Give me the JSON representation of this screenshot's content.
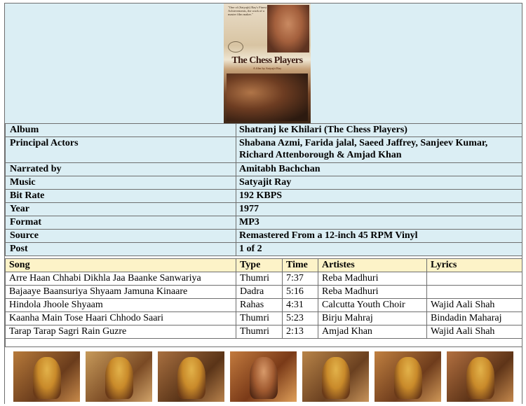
{
  "poster": {
    "quote": "\"One of (Satyajit) Ray's Finest Achievements, the work of a master film maker.\"",
    "title": "The Chess Players",
    "subtitle": "A film by Satyajit Ray"
  },
  "info": [
    {
      "label": "Album",
      "value": "Shatranj ke Khilari (The Chess Players)"
    },
    {
      "label": "Principal Actors",
      "value": "Shabana Azmi, Farida jalal, Saeed Jaffrey, Sanjeev Kumar, Richard Attenborough & Amjad Khan"
    },
    {
      "label": "Narrated by",
      "value": "Amitabh Bachchan"
    },
    {
      "label": "Music",
      "value": "Satyajit Ray"
    },
    {
      "label": "Bit Rate",
      "value": "192 KBPS"
    },
    {
      "label": "Year",
      "value": "1977"
    },
    {
      "label": "Format",
      "value": "MP3"
    },
    {
      "label": "Source",
      "value": "Remastered From a 12-inch 45 RPM Vinyl"
    },
    {
      "label": "Post",
      "value": "1 of 2"
    }
  ],
  "songs": {
    "headers": [
      "Song",
      "Type",
      "Time",
      "Artistes",
      "Lyrics"
    ],
    "rows": [
      [
        "Arre Haan Chhabi Dikhla Jaa Baanke Sanwariya",
        "Thumri",
        "7:37",
        "Reba Madhuri",
        ""
      ],
      [
        "Bajaaye Baansuriya Shyaam Jamuna Kinaare",
        "Dadra",
        "5:16",
        "Reba Madhuri",
        ""
      ],
      [
        "Hindola Jhoole Shyaam",
        "Rahas",
        "4:31",
        "Calcutta Youth Choir",
        "Wajid Aali Shah"
      ],
      [
        "Kaanha Main Tose Haari Chhodo Saari",
        "Thumri",
        "5:23",
        "Birju Mahraj",
        "Bindadin Maharaj"
      ],
      [
        "Tarap Tarap Sagri Rain Guzre",
        "Thumri",
        "2:13",
        "Amjad Khan",
        "Wajid Aali Shah"
      ]
    ]
  }
}
